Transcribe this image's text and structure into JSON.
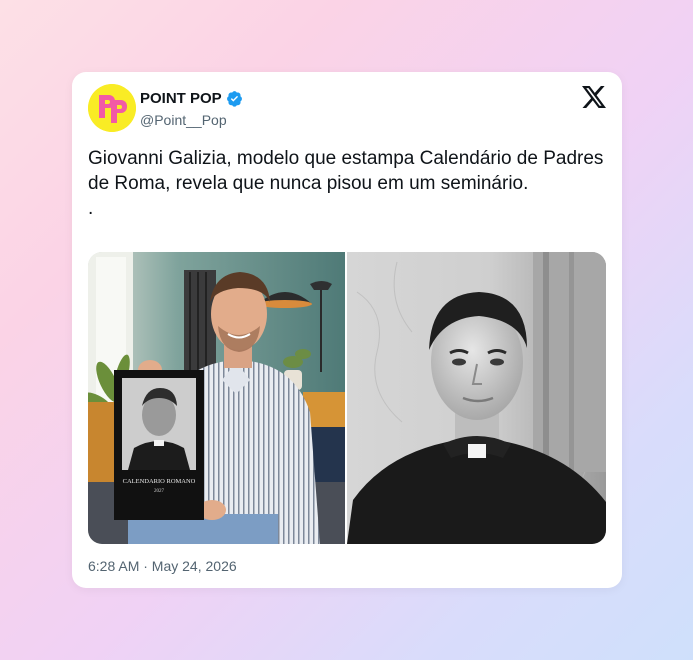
{
  "account": {
    "name": "POINT POP",
    "handle": "@Point__Pop",
    "avatar_text": "PP",
    "verified": true
  },
  "tweet": {
    "text": "Giovanni Galizia, modelo que estampa Calendário de Padres de Roma, revela que nunca pisou em um seminário.\n.",
    "timestamp": "6:28 AM · May 24, 2026"
  },
  "media": {
    "left_photo_frame_caption": "CALENDARIO ROMANO",
    "left_photo_frame_year": "2027"
  },
  "colors": {
    "avatar_bg": "#f9ec25",
    "avatar_letters": "#f25aa5",
    "verified": "#1d9bf0",
    "text": "#0f1419",
    "muted": "#536471"
  },
  "icons": [
    "verified-badge-icon",
    "x-logo-icon"
  ]
}
